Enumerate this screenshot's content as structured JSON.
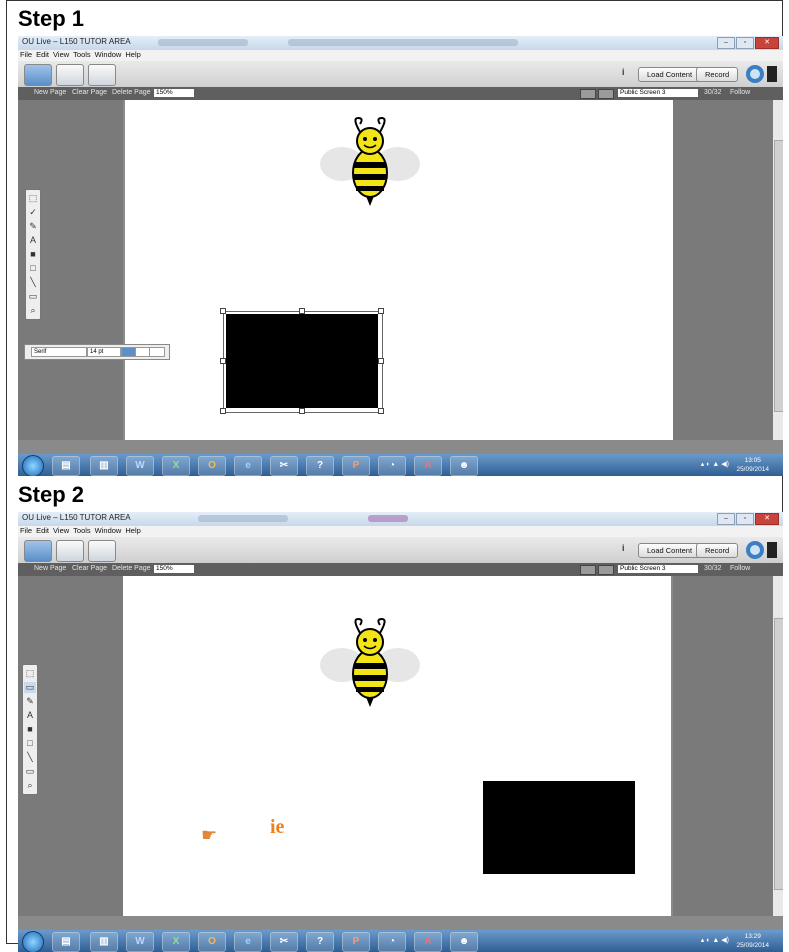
{
  "steps": [
    {
      "title": "Step 1",
      "window_title": "OU Live – L150 TUTOR AREA",
      "menu": [
        "File",
        "Edit",
        "View",
        "Tools",
        "Window",
        "Help"
      ],
      "toolbar": {
        "load_content": "Load Content",
        "record": "Record"
      },
      "subbar": {
        "new_page": "New Page",
        "clear_page": "Clear Page",
        "delete_page": "Delete Page",
        "zoom": "150%",
        "screen": "Public Screen 3",
        "page_count": "30/32",
        "follow": "Follow"
      },
      "text_panel": {
        "font": "Serif",
        "size": "14 pt"
      },
      "clock": {
        "time": "13:05",
        "date": "25/09/2014"
      },
      "show_ie": false
    },
    {
      "title": "Step 2",
      "window_title": "OU Live – L150 TUTOR AREA",
      "menu": [
        "File",
        "Edit",
        "View",
        "Tools",
        "Window",
        "Help"
      ],
      "toolbar": {
        "load_content": "Load Content",
        "record": "Record"
      },
      "subbar": {
        "new_page": "New Page",
        "clear_page": "Clear Page",
        "delete_page": "Delete Page",
        "zoom": "150%",
        "screen": "Public Screen 3",
        "page_count": "30/32",
        "follow": "Follow"
      },
      "clock": {
        "time": "13:29",
        "date": "25/09/2014"
      },
      "overlay_text": "ie",
      "show_ie": true
    }
  ],
  "icons": {
    "taskbar": [
      "start-orb-icon",
      "file-explorer-icon",
      "taskbar-app-icon",
      "word-icon",
      "excel-icon",
      "outlook-icon",
      "internet-explorer-icon",
      "snipping-tool-icon",
      "help-icon",
      "powerpoint-icon",
      "network-icon",
      "acrobat-icon",
      "ou-live-icon"
    ],
    "tools": [
      "select-tool-icon",
      "check-tool-icon",
      "pencil-tool-icon",
      "text-tool-icon",
      "fill-rect-tool-icon",
      "rect-tool-icon",
      "line-tool-icon",
      "screen-tool-icon",
      "zoom-tool-icon"
    ]
  },
  "colors": {
    "accent": "#f07f1e",
    "bee_yellow": "#f2e417",
    "rect": "#000000"
  }
}
